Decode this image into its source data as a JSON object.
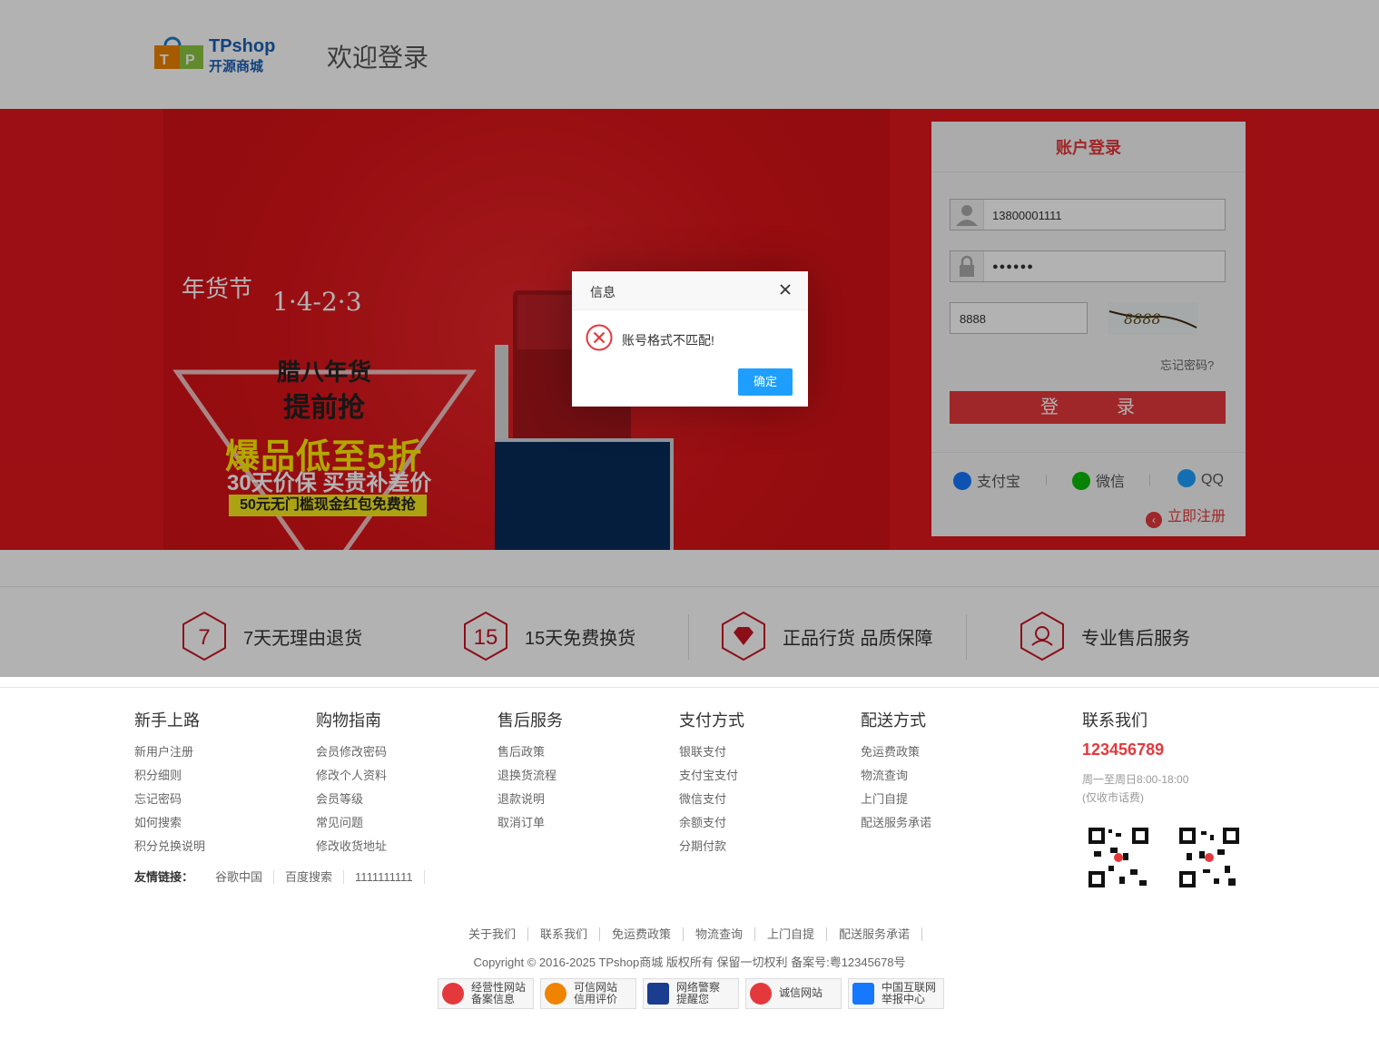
{
  "header": {
    "logo_main": "TPshop",
    "logo_sub": "开源商城",
    "welcome": "欢迎登录"
  },
  "banner": {
    "year_label": "年货节",
    "dates": "1·4-2·3",
    "line1": "腊八年货",
    "line2": "提前抢",
    "line3": "爆品低至5折",
    "line4": "30天价保 买贵补差价",
    "line5": "50元无门槛现金红包免费抢"
  },
  "login": {
    "title": "账户登录",
    "username": "13800001111",
    "password": "●●●●●●",
    "captcha": "8888",
    "forgot": "忘记密码?",
    "submit": "登　录",
    "social": [
      {
        "label": "支付宝",
        "color": "#1677ff"
      },
      {
        "label": "微信",
        "color": "#09bb07"
      },
      {
        "label": "QQ",
        "color": "#1e9fff"
      }
    ],
    "register": "立即注册"
  },
  "dialog": {
    "title": "信息",
    "message": "账号格式不匹配!",
    "ok": "确定"
  },
  "promise": [
    {
      "num": "7",
      "text": "7天无理由退货"
    },
    {
      "num": "15",
      "text": "15天免费换货"
    },
    {
      "num": "",
      "text": "正品行货 品质保障"
    },
    {
      "num": "",
      "text": "专业售后服务"
    }
  ],
  "footer": {
    "columns": [
      {
        "title": "新手上路",
        "links": [
          "新用户注册",
          "积分细则",
          "忘记密码",
          "如何搜索",
          "积分兑换说明"
        ]
      },
      {
        "title": "购物指南",
        "links": [
          "会员修改密码",
          "修改个人资料",
          "会员等级",
          "常见问题",
          "修改收货地址"
        ]
      },
      {
        "title": "售后服务",
        "links": [
          "售后政策",
          "退换货流程",
          "退款说明",
          "取消订单"
        ]
      },
      {
        "title": "支付方式",
        "links": [
          "银联支付",
          "支付宝支付",
          "微信支付",
          "余额支付",
          "分期付款"
        ]
      },
      {
        "title": "配送方式",
        "links": [
          "免运费政策",
          "物流查询",
          "上门自提",
          "配送服务承诺"
        ]
      }
    ],
    "contact": {
      "title": "联系我们",
      "phone": "123456789",
      "hours": "周一至周日8:00-18:00",
      "note": "(仅收市话费)"
    },
    "friend_label": "友情链接：",
    "friend_links": [
      "谷歌中国",
      "百度搜索",
      "1111111111"
    ],
    "bottom_links": [
      "关于我们",
      "联系我们",
      "免运费政策",
      "物流查询",
      "上门自提",
      "配送服务承诺"
    ],
    "copyright": "Copyright © 2016-2025 TPshop商城 版权所有 保留一切权利 备案号:粤12345678号",
    "badges": [
      {
        "line1": "经营性网站",
        "line2": "备案信息",
        "color": "#e4393c"
      },
      {
        "line1": "可信网站",
        "line2": "信用评价",
        "color": "#f08300"
      },
      {
        "line1": "网络警察",
        "line2": "提醒您",
        "color": "#1a3d8f"
      },
      {
        "line1": "诚信网站",
        "line2": "",
        "color": "#e4393c"
      },
      {
        "line1": "中国互联网",
        "line2": "举报中心",
        "color": "#1677ff"
      }
    ]
  }
}
